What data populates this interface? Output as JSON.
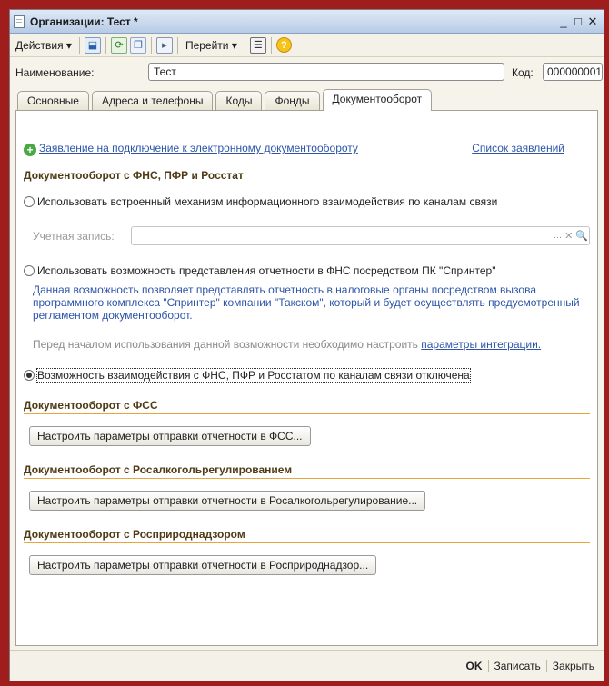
{
  "window": {
    "title": "Организации: Тест *",
    "minimize": "_",
    "maximize": "□",
    "close": "✕"
  },
  "toolbar": {
    "actions_label": "Действия ▾",
    "goto_label": "Перейти ▾",
    "help_label": "?"
  },
  "form": {
    "name_label": "Наименование:",
    "name_value": "Тест",
    "code_label": "Код:",
    "code_value": "000000001"
  },
  "tabs": [
    {
      "label": "Основные"
    },
    {
      "label": "Адреса и телефоны"
    },
    {
      "label": "Коды"
    },
    {
      "label": "Фонды"
    },
    {
      "label": "Документооборот"
    }
  ],
  "active_tab": "Документооборот",
  "content": {
    "application_link": "Заявление на подключение к электронному документообороту",
    "list_link": "Список заявлений",
    "section_fns": {
      "heading": "Документооборот с ФНС, ПФР и Росстат",
      "option_builtin": "Использовать встроенный механизм информационного взаимодействия по каналам связи",
      "account_label": "Учетная запись:",
      "account_value": "",
      "account_buttons": [
        "...",
        "✕",
        "🔍"
      ],
      "option_sprinter": "Использовать возможность представления отчетности в ФНС посредством ПК \"Спринтер\"",
      "sprinter_desc": "Данная возможность позволяет представлять отчетность в налоговые органы посредством вызова программного комплекса \"Спринтер\" компании \"Такском\", который и будет осуществлять предусмотренный регламентом документооборот.",
      "note_prefix": "Перед началом использования данной возможности необходимо настроить ",
      "note_link": "параметры интеграции.",
      "option_disabled": "Возможность взаимодействия с ФНС, ПФР и Росстатом по каналам связи отключена",
      "selected_option": "option_disabled"
    },
    "section_fss": {
      "heading": "Документооборот с ФСС",
      "button": "Настроить параметры отправки отчетности в ФСС..."
    },
    "section_fsrar": {
      "heading": "Документооборот с Росалкогольрегулированием",
      "button": "Настроить параметры отправки отчетности в Росалкогольрегулирование..."
    },
    "section_rpn": {
      "heading": "Документооборот с Росприроднадзором",
      "button": "Настроить параметры отправки отчетности в Росприроднадзор..."
    }
  },
  "footer": {
    "ok": "OK",
    "save": "Записать",
    "close": "Закрыть"
  },
  "colors": {
    "frame": "#a01d1d",
    "link": "#2e55a8",
    "section_underline": "#e9a53c",
    "panel_bg": "#f6f4ea"
  }
}
